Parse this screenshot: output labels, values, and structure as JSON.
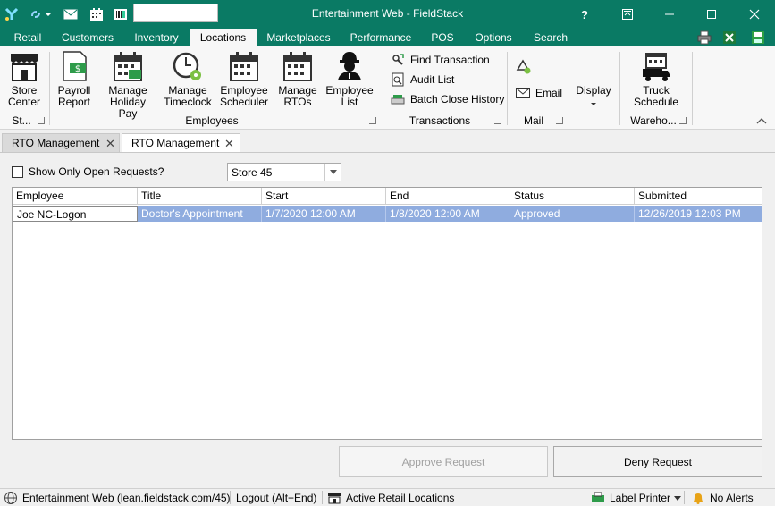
{
  "window": {
    "title": "Entertainment Web - FieldStack",
    "help_label": "?"
  },
  "menu": {
    "tabs": [
      {
        "label": "Retail"
      },
      {
        "label": "Customers"
      },
      {
        "label": "Inventory"
      },
      {
        "label": "Locations"
      },
      {
        "label": "Marketplaces"
      },
      {
        "label": "Performance"
      },
      {
        "label": "POS"
      },
      {
        "label": "Options"
      },
      {
        "label": "Search"
      }
    ],
    "active": "Locations"
  },
  "ribbon": {
    "store_center": {
      "line1": "Store",
      "line2": "Center"
    },
    "group_store_label": "St...",
    "payroll_report": {
      "line1": "Payroll",
      "line2": "Report"
    },
    "manage_holiday_pay": {
      "line1": "Manage",
      "line2": "Holiday Pay"
    },
    "manage_timeclock": {
      "line1": "Manage",
      "line2": "Timeclock"
    },
    "employee_scheduler": {
      "line1": "Employee",
      "line2": "Scheduler"
    },
    "manage_rtos": {
      "line1": "Manage",
      "line2": "RTOs"
    },
    "employee_list": {
      "line1": "Employee",
      "line2": "List"
    },
    "group_employees_label": "Employees",
    "find_transaction": "Find Transaction",
    "audit_list": "Audit List",
    "batch_close_history": "Batch Close History",
    "group_transactions_label": "Transactions",
    "email": "Email",
    "group_mail_label": "Mail",
    "display": "Display",
    "truck_schedule": {
      "line1": "Truck",
      "line2": "Schedule"
    },
    "group_warehouse_label": "Wareho..."
  },
  "doc_tabs": [
    {
      "label": "RTO Management"
    },
    {
      "label": "RTO Management"
    }
  ],
  "filters": {
    "show_open_label": "Show Only Open Requests?",
    "show_open_checked": false,
    "store_selected": "Store 45"
  },
  "grid": {
    "columns": [
      "Employee",
      "Title",
      "Start",
      "End",
      "Status",
      "Submitted"
    ],
    "rows": [
      {
        "employee": "Joe NC-Logon",
        "title": "Doctor's Appointment",
        "start": "1/7/2020 12:00 AM",
        "end": "1/8/2020 12:00 AM",
        "status": "Approved",
        "submitted": "12/26/2019 12:03 PM"
      }
    ]
  },
  "actions": {
    "approve": "Approve Request",
    "deny": "Deny Request"
  },
  "statusbar": {
    "server": "Entertainment Web (lean.fieldstack.com/45)",
    "logout": "Logout (Alt+End)",
    "locations": "Active Retail Locations",
    "label_printer": "Label Printer",
    "alerts": "No Alerts"
  }
}
